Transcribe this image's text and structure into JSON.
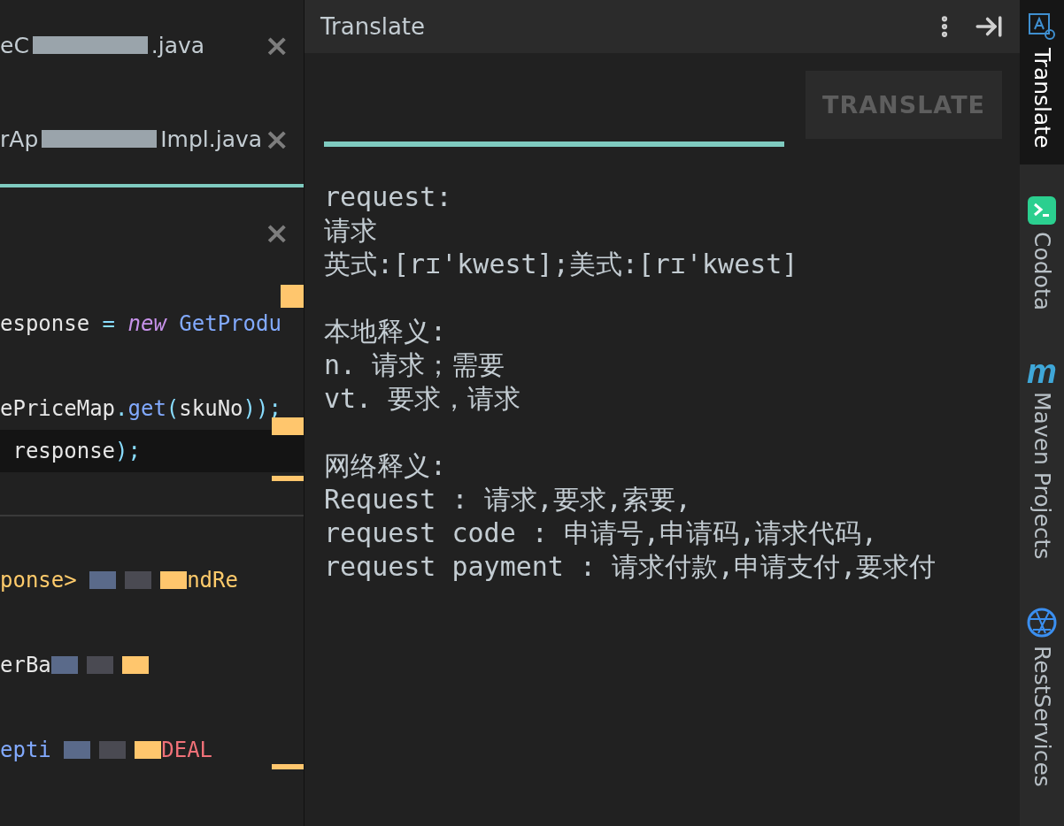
{
  "editor": {
    "tabs": [
      {
        "parts": [
          {
            "kind": "text",
            "text": "eC"
          },
          {
            "kind": "redacted"
          },
          {
            "kind": "text",
            "text": ".java"
          }
        ],
        "selected": false,
        "close": "×"
      },
      {
        "parts": [
          {
            "kind": "text",
            "text": "rAp"
          },
          {
            "kind": "redacted"
          },
          {
            "kind": "text",
            "text": "Impl.java"
          }
        ],
        "selected": true,
        "close": "×"
      },
      {
        "selected": false,
        "close": "×"
      }
    ],
    "code_lines": [
      {
        "highlighted": false,
        "tokens": [
          {
            "kind": "plain",
            "text": "esponse "
          },
          {
            "kind": "op",
            "text": "= "
          },
          {
            "kind": "keyword",
            "text": "new "
          },
          {
            "kind": "type",
            "text": "GetProdu"
          }
        ]
      },
      {
        "highlighted": false,
        "tokens": [
          {
            "kind": "plain",
            "text": "ePriceMap"
          },
          {
            "kind": "op",
            "text": "."
          },
          {
            "kind": "method",
            "text": "get"
          },
          {
            "kind": "op",
            "text": "("
          },
          {
            "kind": "plain",
            "text": "skuNo"
          },
          {
            "kind": "op",
            "text": "));"
          }
        ]
      },
      {
        "highlighted": true,
        "tokens": [
          {
            "kind": "plain",
            "text": " response"
          },
          {
            "kind": "op",
            "text": ");"
          }
        ]
      },
      {
        "highlighted": false,
        "tokens": [
          {
            "kind": "generic",
            "text": "ponse> "
          },
          {
            "kind": "redacted"
          },
          {
            "kind": "generic",
            "text": "ndRe"
          }
        ]
      },
      {
        "highlighted": false,
        "tokens": [
          {
            "kind": "plain",
            "text": "erBa"
          },
          {
            "kind": "redacted"
          }
        ]
      },
      {
        "highlighted": false,
        "tokens": [
          {
            "kind": "type",
            "text": "epti "
          },
          {
            "kind": "redacted"
          },
          {
            "kind": "constant",
            "text": "DEAL"
          }
        ]
      }
    ]
  },
  "translate_panel": {
    "title": "Translate",
    "button": "TRANSLATE",
    "result": [
      [
        "request:",
        "请求",
        "英式:[rɪ'kwest];美式:[rɪ'kwest]"
      ],
      [
        "本地释义:",
        "n. 请求；需要",
        "vt. 要求，请求"
      ],
      [
        "网络释义:",
        "Request : 请求,要求,索要,",
        "request code : 申请号,申请码,请求代码,",
        "request payment : 请求付款,申请支付,要求付"
      ]
    ]
  },
  "tool_strip": [
    {
      "kind": "translate",
      "label": "Translate",
      "selected": true
    },
    {
      "kind": "codota",
      "label": "Codota",
      "selected": false
    },
    {
      "kind": "maven",
      "label": "Maven Projects",
      "glyph": "m",
      "selected": false
    },
    {
      "kind": "rest",
      "label": "RestServices",
      "selected": false
    }
  ]
}
